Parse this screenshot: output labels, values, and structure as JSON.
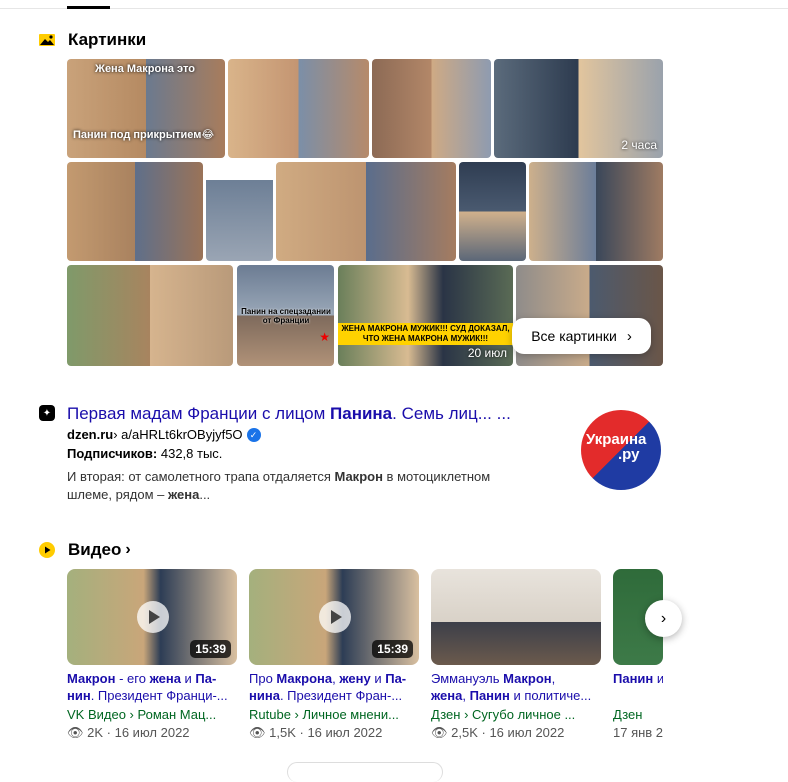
{
  "images_section": {
    "title": "Картинки",
    "all_button": "Все картинки",
    "tiles": [
      {
        "caption_top": "Жена Макрона это",
        "caption_bottom": "Панин под прикрытием😂"
      },
      {},
      {},
      {
        "badge": "2 часа"
      },
      {},
      {},
      {},
      {},
      {},
      {},
      {
        "caption": "Панин на спецзадании от Франции"
      },
      {
        "banner": "ЖЕНА МАКРОНА МУЖИК!!! СУД ДОКАЗАЛ, ЧТО ЖЕНА МАКРОНА МУЖИК!!!",
        "badge": "20 июл"
      },
      {}
    ]
  },
  "result": {
    "title_part1": "Первая мадам Франции с лицом ",
    "title_bold": "Панина",
    "title_part2": ". Семь лиц... ...",
    "domain": "dzen.ru",
    "path": " › a/aHRLt6krOByjyf5O",
    "subs_label": "Подписчиков:",
    "subs_value": " 432,8 тыс.",
    "snippet_1": "И вторая: от самолетного трапа отдаляется ",
    "snippet_bold1": "Макрон",
    "snippet_2": " в мотоциклетном шлеме, рядом – ",
    "snippet_bold2": "жена",
    "snippet_3": "...",
    "logo_line1": "Украина",
    "logo_line2": ".ру"
  },
  "video_section": {
    "title": "Видео",
    "videos": [
      {
        "t1": "Макрон",
        "t2": " - его ",
        "t3": "жена",
        "t4": " и ",
        "t5": "Па-",
        "t6": "нин",
        "t7": ". Президент Франци-...",
        "duration": "15:39",
        "source": "VK Видео › Роман Мац...",
        "views": "2K",
        "date": "16 июл 2022"
      },
      {
        "t1": "Про ",
        "t2": "Макрона",
        "t3": ", ",
        "t4": "жену",
        "t5": " и ",
        "t6": "Па-нина",
        "t7": ". Президент Фран-...",
        "duration": "15:39",
        "source": "Rutube › Личное мнени...",
        "views": "1,5K",
        "date": "16 июл 2022"
      },
      {
        "t1": "Эммануэль ",
        "t2": "Макрон",
        "t3": ", ",
        "t4": "жена",
        "t5": ", ",
        "t6": "Панин",
        "t7": " и политиче...",
        "duration": "",
        "source": "Дзен › Сугубо личное ...",
        "views": "2,5K",
        "date": "16 июл 2022"
      },
      {
        "t1": "",
        "t2": "Панин",
        "t3": " и",
        "t4": "",
        "t5": "",
        "t6": "",
        "t7": "",
        "duration": "",
        "source": "Дзен",
        "views": "",
        "date": "17 янв 2"
      }
    ]
  }
}
